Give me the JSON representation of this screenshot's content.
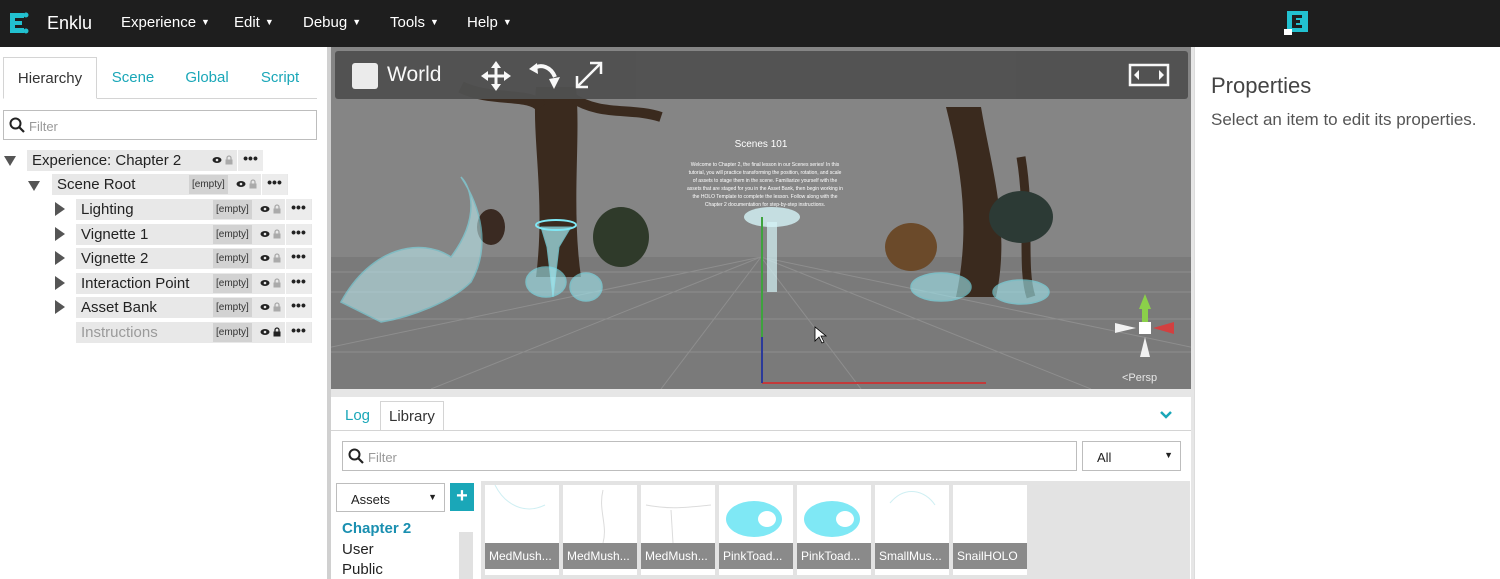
{
  "app": {
    "name": "Enklu"
  },
  "menu": [
    {
      "label": "Experience"
    },
    {
      "label": "Edit"
    },
    {
      "label": "Debug"
    },
    {
      "label": "Tools"
    },
    {
      "label": "Help"
    }
  ],
  "left_tabs": [
    {
      "label": "Hierarchy"
    },
    {
      "label": "Scene"
    },
    {
      "label": "Global"
    },
    {
      "label": "Script"
    }
  ],
  "hierarchy_filter": {
    "placeholder": "Filter"
  },
  "hierarchy": {
    "experience": "Experience: Chapter 2",
    "scene_root": "Scene Root",
    "scene_root_badge": "[empty]",
    "children": [
      {
        "label": "Lighting",
        "badge": "[empty]"
      },
      {
        "label": "Vignette 1",
        "badge": "[empty]"
      },
      {
        "label": "Vignette 2",
        "badge": "[empty]"
      },
      {
        "label": "Interaction Point",
        "badge": "[empty]"
      },
      {
        "label": "Asset Bank",
        "badge": "[empty]"
      },
      {
        "label": "Instructions",
        "badge": "[empty]"
      }
    ],
    "more": "•••"
  },
  "viewport": {
    "space_label": "World",
    "scene_title": "Scenes 101",
    "scene_text": "Welcome to Chapter 2, the final lesson in our Scenes series! In this tutorial, you will practice transforming the position, rotation, and scale of assets to stage them in the scene. Familiarize yourself with the assets that are staged for you in the Asset Bank, then begin working in the HOLO Template to complete the lesson. Follow along with the Chapter 2 documentation for step-by-step instructions.",
    "camera_label": "<Persp"
  },
  "properties": {
    "title": "Properties",
    "message": "Select an item to edit its properties."
  },
  "bottom_tabs": [
    {
      "label": "Log"
    },
    {
      "label": "Library"
    }
  ],
  "library": {
    "filter_placeholder": "Filter",
    "type_select": "All",
    "category_select": "Assets",
    "add": "+",
    "folders": [
      {
        "label": "Chapter 2"
      },
      {
        "label": "User"
      },
      {
        "label": "Public"
      }
    ],
    "assets": [
      {
        "name": "MedMush...",
        "kind": "outline"
      },
      {
        "name": "MedMush...",
        "kind": "outline"
      },
      {
        "name": "MedMush...",
        "kind": "outline"
      },
      {
        "name": "PinkToad...",
        "kind": "solid"
      },
      {
        "name": "PinkToad...",
        "kind": "solid"
      },
      {
        "name": "SmallMus...",
        "kind": "outline"
      },
      {
        "name": "SnailHOLO",
        "kind": "blank"
      }
    ]
  },
  "colors": {
    "accent": "#1aa7b8",
    "topbar": "#1e1e1e",
    "viewport": "#7c7c7c",
    "holo": "#7fe8f5"
  }
}
